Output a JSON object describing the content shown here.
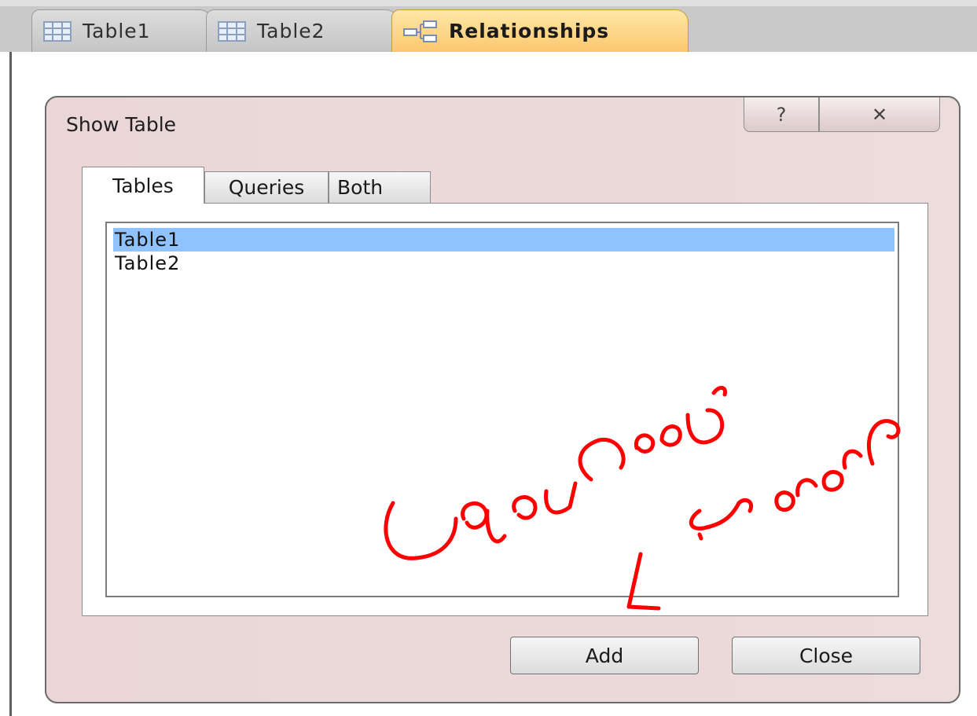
{
  "document_tabs": [
    {
      "label": "Table1",
      "icon": "table-grid-icon",
      "active": false
    },
    {
      "label": "Table2",
      "icon": "table-grid-icon",
      "active": false
    },
    {
      "label": "Relationships",
      "icon": "relationships-icon",
      "active": true
    }
  ],
  "dialog": {
    "title": "Show Table",
    "help_glyph": "?",
    "close_glyph": "✕",
    "tabs": [
      "Tables",
      "Queries",
      "Both"
    ],
    "selected_tab": "Tables",
    "tables": [
      "Table1",
      "Table2"
    ],
    "selected_table": "Table1",
    "add_label": "Add",
    "close_label": "Close"
  },
  "colors": {
    "selection": "#8fc3ff",
    "active_tab": "#fbc870",
    "annotation": "#ff0000"
  }
}
